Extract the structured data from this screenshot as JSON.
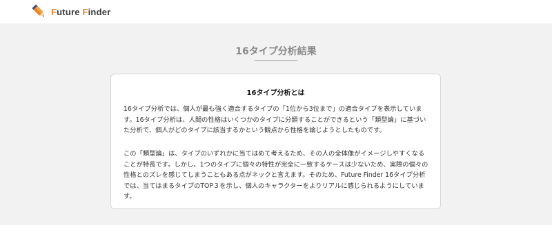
{
  "header": {
    "logo_icon": "pencil-logo-icon",
    "logo_first_letter": "F",
    "logo_rest_1": "uture ",
    "logo_second_letter": "F",
    "logo_rest_2": "inder",
    "accent_color": "#e8872e"
  },
  "page": {
    "title": "16タイプ分析結果"
  },
  "card": {
    "title": "16タイプ分析とは",
    "paragraph1": "16タイプ分析では、個人が最も強く適合するタイプの「1位から3位まで」の適合タイプを表示しています。16タイプ分析は、人間の性格はいくつかのタイプに分類することができるという「類型論」に基づいた分析で、個人がどのタイプに該当するかという観点から性格を論じようとしたものです。",
    "paragraph2": "この「類型論」は、タイプのいずれかに当てはめて考えるため、その人の全体像がイメージしやすくなることが特長です。しかし、1つのタイプに個々の特性が完全に一致するケースは少ないため、実際の個々の性格とのズレを感じてしまうこともある点がネックと言えます。そのため、Future Finder 16タイプ分析では、当てはまるタイプのTOP３を示し、個人のキャラクターをよりリアルに感じられるようにしています。"
  }
}
